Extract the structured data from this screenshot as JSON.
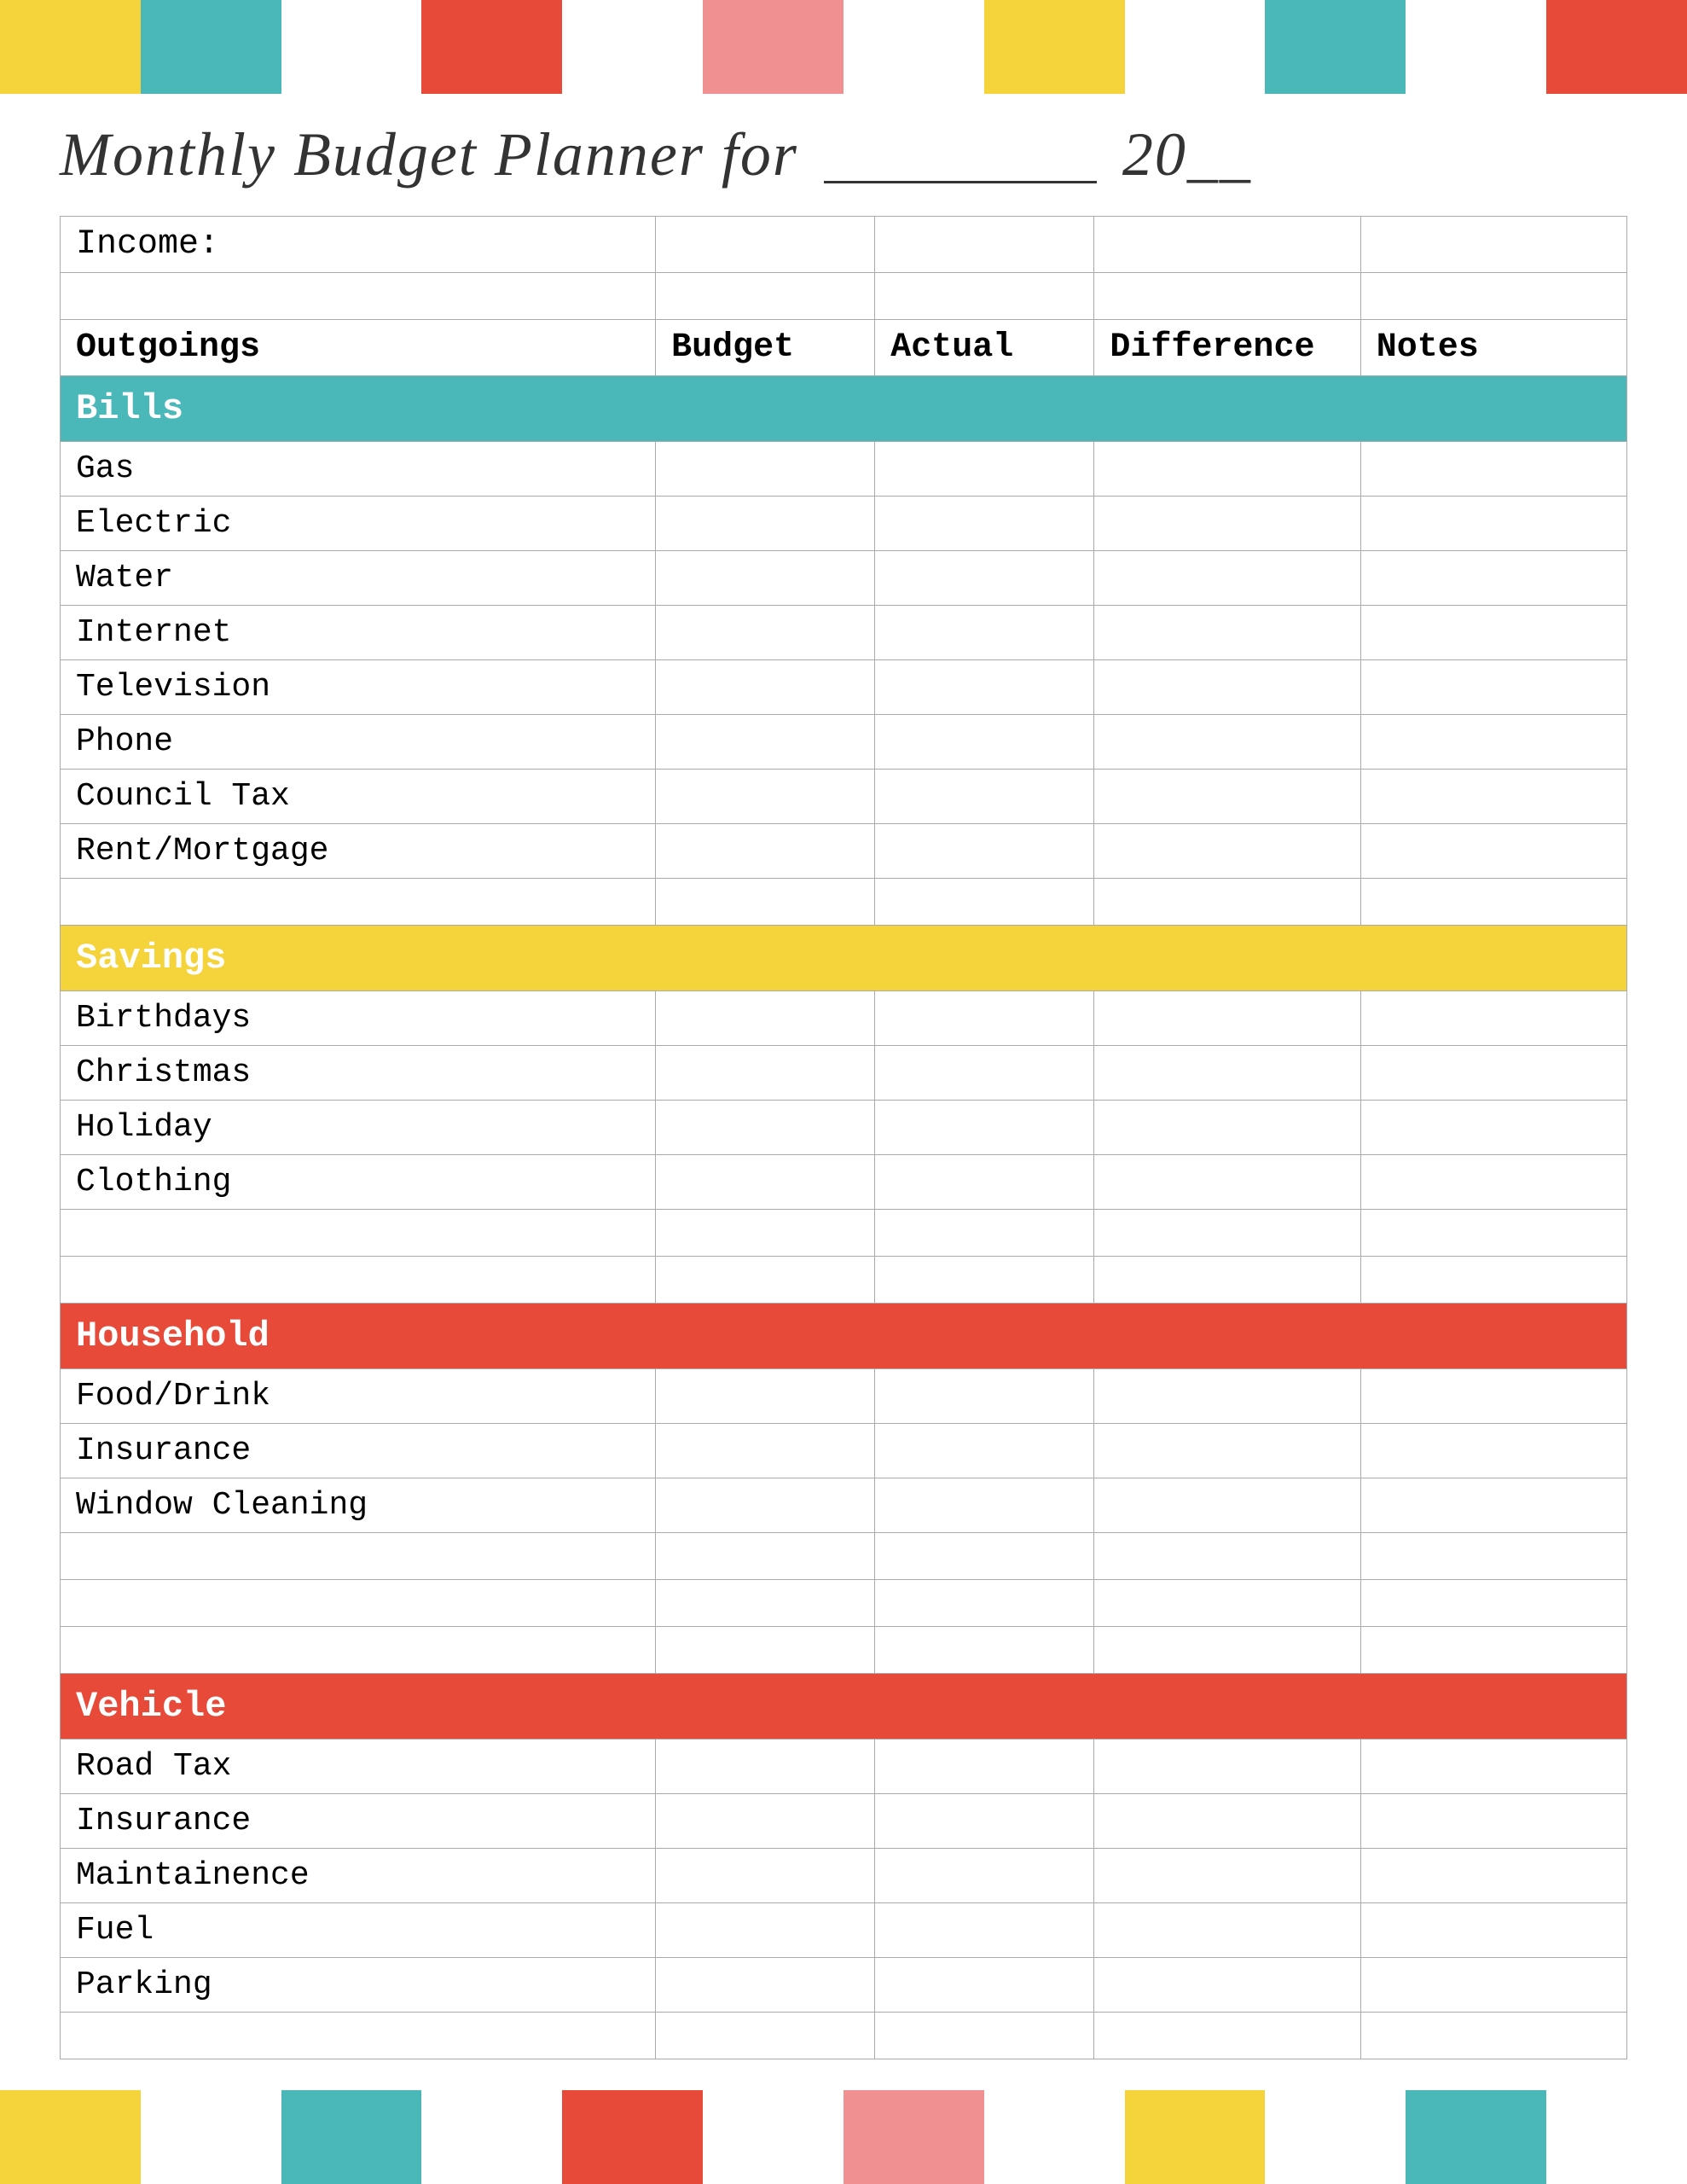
{
  "colors": {
    "yellow": "#f5d33a",
    "teal": "#4ab8b8",
    "red": "#e84a3a",
    "pink": "#f09090",
    "white": "#ffffff"
  },
  "colorBarTop": [
    "yellow",
    "teal",
    "white",
    "red",
    "white",
    "pink",
    "white",
    "yellow",
    "white",
    "teal",
    "white",
    "red"
  ],
  "colorBarBottom": [
    "yellow",
    "white",
    "teal",
    "white",
    "red",
    "white",
    "pink",
    "white",
    "yellow",
    "white",
    "teal",
    "white"
  ],
  "title": "Monthly Budget Planner for",
  "title_blank": "___________",
  "title_year_prefix": "20",
  "title_year_blank": "__",
  "table": {
    "income_label": "Income:",
    "columns": {
      "outgoings": "Outgoings",
      "budget": "Budget",
      "actual": "Actual",
      "difference": "Difference",
      "notes": "Notes"
    },
    "sections": [
      {
        "name": "Bills",
        "color": "teal",
        "items": [
          "Gas",
          "Electric",
          "Water",
          "Internet",
          "Television",
          "Phone",
          "Council Tax",
          "Rent/Mortgage"
        ]
      },
      {
        "name": "Savings",
        "color": "savings",
        "items": [
          "Birthdays",
          "Christmas",
          "Holiday",
          "Clothing"
        ]
      },
      {
        "name": "Household",
        "color": "household",
        "items": [
          "Food/Drink",
          "Insurance",
          "Window Cleaning"
        ]
      },
      {
        "name": "Vehicle",
        "color": "vehicle",
        "items": [
          "Road Tax",
          "Insurance",
          "Maintainence",
          "Fuel",
          "Parking"
        ]
      }
    ]
  }
}
